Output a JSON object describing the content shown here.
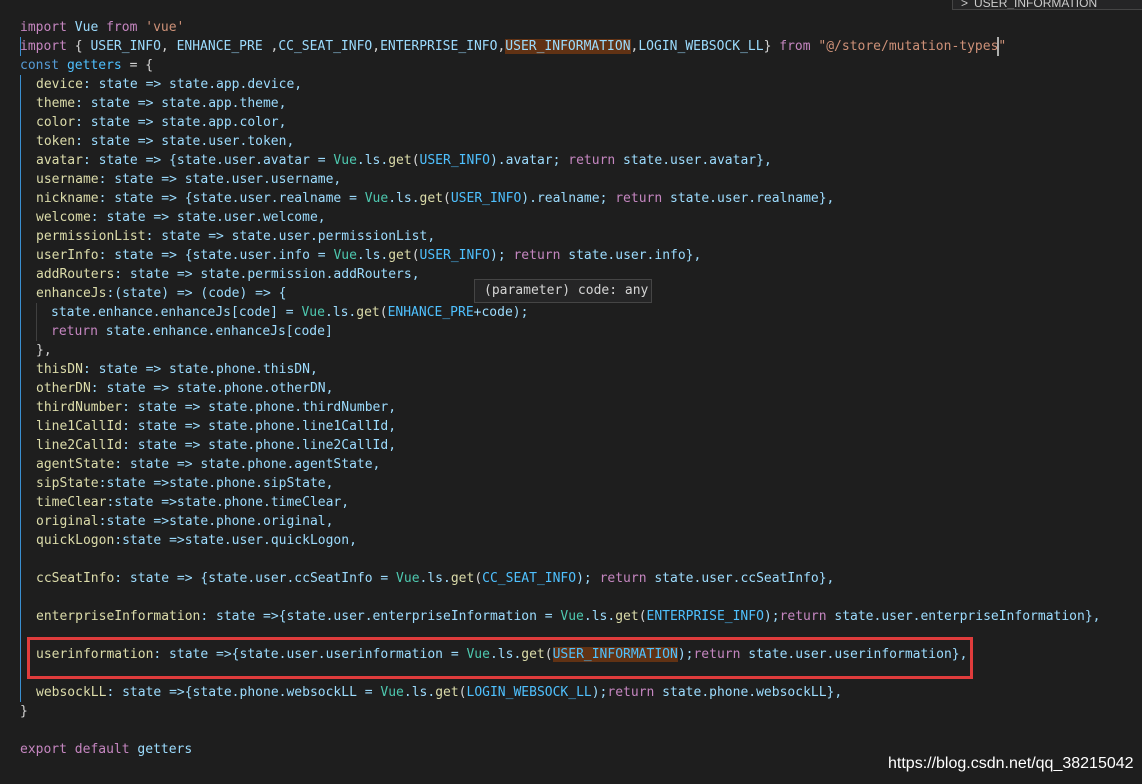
{
  "find_widget": {
    "chevron": ">",
    "query": "USER_INFORMATION"
  },
  "hover_tooltip": {
    "text": "(parameter) code: any"
  },
  "watermark": "https://blog.csdn.net/qq_38215042",
  "code": {
    "l1": {
      "import": "import",
      "vue": "Vue",
      "from": "from",
      "src": "'vue'"
    },
    "l2": {
      "import": "import",
      "open": "{",
      "a": "USER_INFO",
      "sep1": ",",
      "b": "ENHANCE_PRE",
      "sep2": " ,",
      "c": "CC_SEAT_INFO",
      "sep3": ",",
      "d": "ENTERPRISE_INFO",
      "sep4": ",",
      "e": "USER_INFORMATION",
      "sep5": ",",
      "f": "LOGIN_WEBSOCK_LL",
      "close": "}",
      "from": "from",
      "src": "\"@/store/mutation-types\""
    },
    "l3": {
      "kw": "const",
      "name": "getters",
      "rest": " = {"
    },
    "l4": {
      "key": "device",
      "rest": ": state => state.app.device,"
    },
    "l5": {
      "key": "theme",
      "rest": ": state => state.app.theme,"
    },
    "l6": {
      "key": "color",
      "rest": ": state => state.app.color,"
    },
    "l7": {
      "key": "token",
      "rest": ": state => state.user.token,"
    },
    "l8": {
      "key": "avatar",
      "p1": ": state => {state.user.avatar = ",
      "vue": "Vue",
      "p2": ".ls.",
      "get": "get",
      "p3": "(",
      "const": "USER_INFO",
      "p4": ").avatar; ",
      "ret": "return",
      "p5": " state.user.avatar},"
    },
    "l9": {
      "key": "username",
      "rest": ": state => state.user.username,"
    },
    "l10": {
      "key": "nickname",
      "p1": ": state => {state.user.realname = ",
      "vue": "Vue",
      "p2": ".ls.",
      "get": "get",
      "p3": "(",
      "const": "USER_INFO",
      "p4": ").realname; ",
      "ret": "return",
      "p5": " state.user.realname},"
    },
    "l11": {
      "key": "welcome",
      "rest": ": state => state.user.welcome,"
    },
    "l12": {
      "key": "permissionList",
      "rest": ": state => state.user.permissionList,"
    },
    "l13": {
      "key": "userInfo",
      "p1": ": state => {state.user.info = ",
      "vue": "Vue",
      "p2": ".ls.",
      "get": "get",
      "p3": "(",
      "const": "USER_INFO",
      "p4": "); ",
      "ret": "return",
      "p5": " state.user.info},"
    },
    "l14": {
      "key": "addRouters",
      "rest": ": state => state.permission.addRouters,"
    },
    "l15": {
      "key": "enhanceJs",
      "rest": ":(state) => (code) => {"
    },
    "l16": {
      "p1": "state.enhance.enhanceJs[code] = ",
      "vue": "Vue",
      "p2": ".ls.",
      "get": "get",
      "p3": "(",
      "const": "ENHANCE_PRE",
      "p4": "+code);"
    },
    "l17": {
      "ret": "return",
      "p1": " state.enhance.enhanceJs[code]"
    },
    "l18": {
      "text": "},"
    },
    "l19": {
      "key": "thisDN",
      "rest": ": state => state.phone.thisDN,"
    },
    "l20": {
      "key": "otherDN",
      "rest": ": state => state.phone.otherDN,"
    },
    "l21": {
      "key": "thirdNumber",
      "rest": ": state => state.phone.thirdNumber,"
    },
    "l22": {
      "key": "line1CallId",
      "rest": ": state => state.phone.line1CallId,"
    },
    "l23": {
      "key": "line2CallId",
      "rest": ": state => state.phone.line2CallId,"
    },
    "l24": {
      "key": "agentState",
      "rest": ": state => state.phone.agentState,"
    },
    "l25": {
      "key": "sipState",
      "rest": ":state =>state.phone.sipState,"
    },
    "l26": {
      "key": "timeClear",
      "rest": ":state =>state.phone.timeClear,"
    },
    "l27": {
      "key": "original",
      "rest": ":state =>state.phone.original,"
    },
    "l28": {
      "key": "quickLogon",
      "rest": ":state =>state.user.quickLogon,"
    },
    "l29": {
      "key": "ccSeatInfo",
      "p1": ": state => {state.user.ccSeatInfo = ",
      "vue": "Vue",
      "p2": ".ls.",
      "get": "get",
      "p3": "(",
      "const": "CC_SEAT_INFO",
      "p4": "); ",
      "ret": "return",
      "p5": " state.user.ccSeatInfo},"
    },
    "l30": {
      "key": "enterpriseInformation",
      "p1": ": state =>{state.user.enterpriseInformation = ",
      "vue": "Vue",
      "p2": ".ls.",
      "get": "get",
      "p3": "(",
      "const": "ENTERPRISE_INFO",
      "p4": ");",
      "ret": "return",
      "p5": " state.user.enterpriseInformation},"
    },
    "l31": {
      "key": "userinformation",
      "p1": ": state =>{state.user.userinformation = ",
      "vue": "Vue",
      "p2": ".ls.",
      "get": "get",
      "p3": "(",
      "const": "USER_INFORMATION",
      "p4": ");",
      "ret": "return",
      "p5": " state.user.userinformation},"
    },
    "l32": {
      "key": "websockLL",
      "p1": ": state =>{state.phone.websockLL = ",
      "vue": "Vue",
      "p2": ".ls.",
      "get": "get",
      "p3": "(",
      "const": "LOGIN_WEBSOCK_LL",
      "p4": ");",
      "ret": "return",
      "p5": " state.phone.websockLL},"
    },
    "l33": {
      "text": "}"
    },
    "l34": {
      "kw": "export",
      "kw2": "default",
      "name": "getters"
    }
  }
}
